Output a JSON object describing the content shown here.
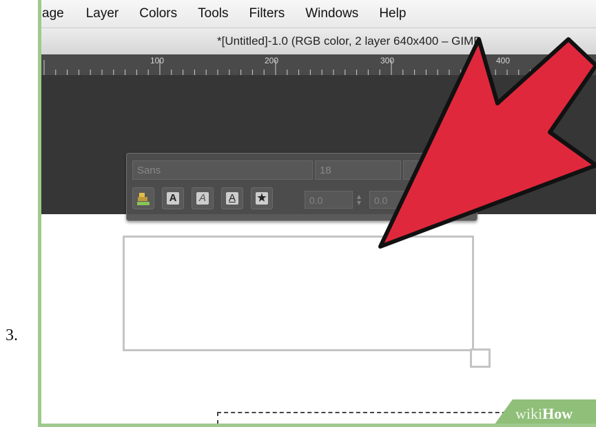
{
  "step": {
    "number": "3."
  },
  "menubar": {
    "items": [
      "age",
      "Layer",
      "Colors",
      "Tools",
      "Filters",
      "Windows",
      "Help"
    ]
  },
  "window": {
    "title": "*[Untitled]-1.0 (RGB color, 2 layer   640x400 – GIMP"
  },
  "ruler": {
    "labels": [
      "100",
      "200",
      "300",
      "400"
    ]
  },
  "text_toolbox": {
    "font": "Sans",
    "size": "18",
    "baseline_offset": "0.0",
    "kerning": "0.0",
    "buttons": [
      "text-color-swatch",
      "bold",
      "italic",
      "underline",
      "strikethrough"
    ]
  },
  "watermark": {
    "wiki": "wiki",
    "how": "How"
  },
  "colors": {
    "arrow": "#e0283c",
    "frame": "#9fc98e",
    "dark_canvas": "#363636"
  }
}
